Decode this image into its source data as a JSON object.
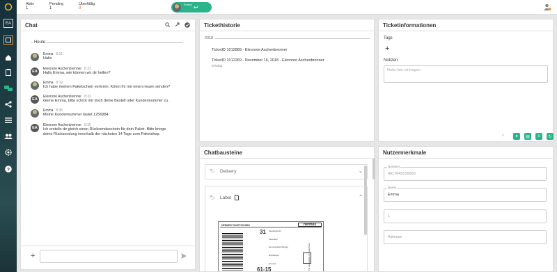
{
  "sidebar": {
    "badge_top": "EA"
  },
  "topbar": {
    "stats": [
      {
        "label": "Aktiv",
        "value": "1"
      },
      {
        "label": "Pending",
        "value": "1"
      },
      {
        "label": "Überfällig",
        "value": "0"
      }
    ],
    "pill_label": "Emma"
  },
  "chat": {
    "title": "Chat",
    "date_divider": "Heute",
    "messages": [
      {
        "author": "Emma",
        "time": "8:31",
        "text": [
          "Hallo"
        ],
        "avatar": "photo"
      },
      {
        "author": "Eleonore Aschenbrenner",
        "time": "8:32",
        "text": [
          "Hallo Emma, wie können wir dir helfen?"
        ],
        "avatar": "EA"
      },
      {
        "author": "Emma",
        "time": "8:32",
        "text": [
          "Ich habe meinen Paketschein verloren. Könnt ihr mir einen neuen senden?"
        ],
        "avatar": "photo"
      },
      {
        "author": "Eleonore Aschenbrenner",
        "time": "8:33",
        "text": [
          "Gerne Emma, bitte schick mir doch deine Bestell oder Kundennummer zu."
        ],
        "avatar": "EA"
      },
      {
        "author": "Emma",
        "time": "8:35",
        "text": [
          "Meine Kundennummer lautet 1256984"
        ],
        "avatar": "photo"
      },
      {
        "author": "Eleonore Aschenbrenner",
        "time": "8:36",
        "text": [
          "Ich erstelle dir gleich einen Rücksendeschein für dein Paket. Bitte bringe",
          "deine Rücksendung innerhalb der nächsten 14 Tage zum Paketshop."
        ],
        "avatar": "EA"
      }
    ]
  },
  "history": {
    "title": "Tickethistorie",
    "year": "2018",
    "items": [
      {
        "title": "TicketID 1012889 - Eleonore Aschenbrenner",
        "sub": ""
      },
      {
        "title": "TicketID 1012269 - November 16, 2018 - Eleonore Aschenbrenner",
        "sub": "Erledigt"
      }
    ]
  },
  "info": {
    "title": "Ticketinformationen",
    "tags_label": "Tags",
    "notes_label": "Notizen",
    "notes_placeholder": "Notiz hier eintragen"
  },
  "bausteine": {
    "title": "Chatbausteine",
    "delivery": "Delivery",
    "label": "Label"
  },
  "label_doc": {
    "header": "HERMES PAKETSCHEIN",
    "brand": "Hermes",
    "big_number": "31",
    "code": "61-15",
    "side_text": "Für die Abgabe im PaketShop",
    "small_lines": [
      "Sendungs-ID",
      "Absender",
      "Hermes Einrichtungs",
      "Empfänger",
      "Hermes"
    ]
  },
  "user": {
    "title": "Nutzermerkmale",
    "fields": [
      {
        "label": "Nummer",
        "value": "4917645130650"
      },
      {
        "label": "Name",
        "value": "Emma"
      },
      {
        "label": "",
        "value": "1"
      },
      {
        "label": "",
        "value": "Adresse"
      }
    ]
  },
  "icons": {
    "sidebar": [
      "logo-ring-icon",
      "window-icon",
      "home-icon",
      "clipboard-icon",
      "chat-swap-icon",
      "share-icon",
      "list-icon",
      "users-icon",
      "settings-icon",
      "help-icon"
    ]
  }
}
